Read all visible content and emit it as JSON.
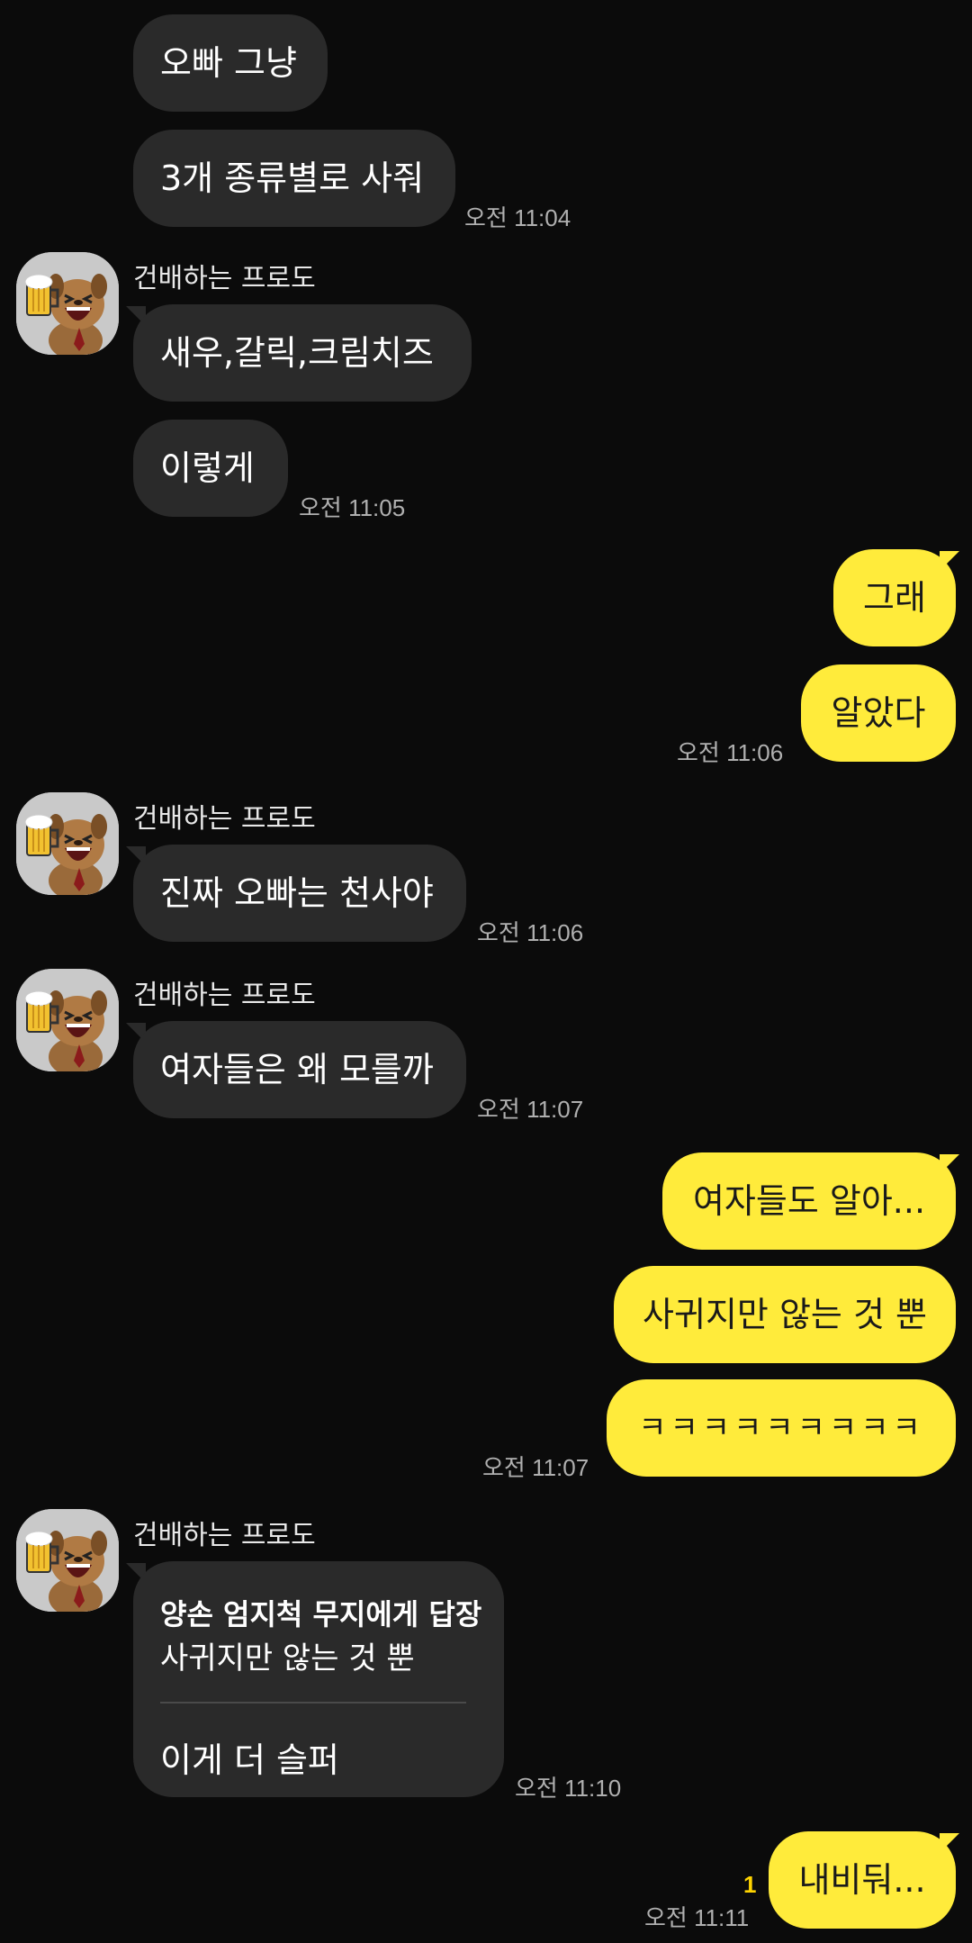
{
  "sender_name": "건배하는 프로도",
  "messages": {
    "m1": "오빠 그냥",
    "m2": "3개 종류별로 사줘",
    "t2": "오전 11:04",
    "m3": "새우,갈릭,크림치즈",
    "m4": "이렇게",
    "t4": "오전 11:05",
    "m5": "그래",
    "m6": "알았다",
    "t6": "오전 11:06",
    "m7": "진짜 오빠는 천사야",
    "t7": "오전 11:06",
    "m8": "여자들은 왜 모를까",
    "t8": "오전 11:07",
    "m9": "여자들도 알아...",
    "m10": "사귀지만 않는 것 뿐",
    "m11": "ㅋㅋㅋㅋㅋㅋㅋㅋㅋ",
    "t11": "오전 11:07",
    "reply_header": "양손 엄지척 무지에게 답장",
    "reply_quote": "사귀지만 않는 것 뿐",
    "reply_text": "이게 더 슬퍼",
    "t12": "오전 11:10",
    "m13": "내비둬...",
    "unread13": "1",
    "t13": "오전 11:11"
  },
  "colors": {
    "background": "#0b0b0b",
    "incoming_bubble": "#2a2a2a",
    "outgoing_bubble": "#ffeb3b",
    "unread": "#ffd400"
  }
}
